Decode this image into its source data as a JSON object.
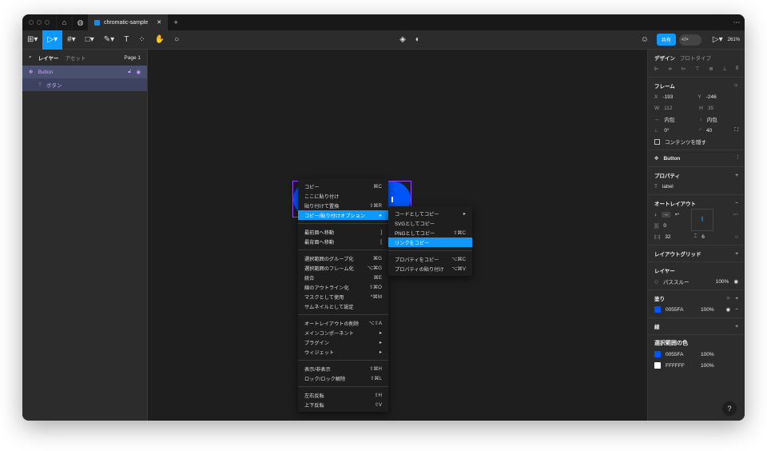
{
  "titlebar": {
    "tab": "chromatic-sample",
    "new_tab": "+",
    "more": "⋯"
  },
  "toolbar": {
    "share": "共有",
    "zoom": "261%"
  },
  "left": {
    "tab_layers": "レイヤー",
    "tab_assets": "アセット",
    "page": "Page 1",
    "layers": [
      {
        "name": "Button"
      },
      {
        "name": "ボタン"
      }
    ]
  },
  "menu": [
    {
      "label": "コピー",
      "key": "⌘C"
    },
    {
      "label": "ここに貼り付け",
      "key": ""
    },
    {
      "label": "貼り付けて置換",
      "key": "⇧⌘R"
    },
    {
      "label": "コピー/貼り付けオプション",
      "key": "▸",
      "highlight": true
    },
    {
      "sep": true
    },
    {
      "label": "最前面へ移動",
      "key": "]"
    },
    {
      "label": "最背面へ移動",
      "key": "["
    },
    {
      "sep": true
    },
    {
      "label": "選択範囲のグループ化",
      "key": "⌘G"
    },
    {
      "label": "選択範囲のフレーム化",
      "key": "⌥⌘G"
    },
    {
      "label": "統合",
      "key": "⌘E"
    },
    {
      "label": "線のアウトライン化",
      "key": "⇧⌘O"
    },
    {
      "label": "マスクとして使用",
      "key": "^⌘M"
    },
    {
      "label": "サムネイルとして設定",
      "key": ""
    },
    {
      "sep": true
    },
    {
      "label": "オートレイアウトの削除",
      "key": "⌥⇧A"
    },
    {
      "label": "メインコンポーネント",
      "key": "▸"
    },
    {
      "label": "プラグイン",
      "key": "▸"
    },
    {
      "label": "ウィジェット",
      "key": "▸"
    },
    {
      "sep": true
    },
    {
      "label": "表示/非表示",
      "key": "⇧⌘H"
    },
    {
      "label": "ロック/ロック解除",
      "key": "⇧⌘L"
    },
    {
      "sep": true
    },
    {
      "label": "左右反転",
      "key": "⇧H"
    },
    {
      "label": "上下反転",
      "key": "⇧V"
    }
  ],
  "submenu": [
    {
      "label": "コードとしてコピー",
      "key": "▸"
    },
    {
      "label": "SVGとしてコピー",
      "key": ""
    },
    {
      "label": "PNGとしてコピー",
      "key": "⇧⌘C"
    },
    {
      "label": "リンクをコピー",
      "key": "",
      "highlight": true
    },
    {
      "sep": true
    },
    {
      "label": "プロパティをコピー",
      "key": "⌥⌘C"
    },
    {
      "label": "プロパティの貼り付け",
      "key": "⌥⌘V"
    }
  ],
  "right": {
    "tab_design": "デザイン",
    "tab_prototype": "プロトタイプ",
    "frame": "フレーム",
    "x_label": "X",
    "x": "-193",
    "y_label": "Y",
    "y": "-246",
    "w_label": "W",
    "w": "112",
    "h_label": "H",
    "h": "35",
    "hug_w": "内包",
    "hug_h": "内包",
    "rotation": "0°",
    "radius": "40",
    "clip": "コンテンツを隠す",
    "component": "Button",
    "properties": "プロパティ",
    "prop_label": "label",
    "autolayout": "オートレイアウト",
    "gap": "0",
    "padding_h": "32",
    "padding_v": "6",
    "layout_grid": "レイアウトグリッド",
    "layer": "レイヤー",
    "blend": "パススルー",
    "layer_opacity": "100%",
    "fill": "塗り",
    "fill_hex": "0055FA",
    "fill_opacity": "100%",
    "stroke": "線",
    "selection_colors": "選択範囲の色",
    "sel1_hex": "0055FA",
    "sel1_opacity": "100%",
    "sel2_hex": "FFFFFF",
    "sel2_opacity": "100%"
  },
  "colors": {
    "accent": "#0d99ff",
    "fill": "#0055fa"
  },
  "help": "?"
}
